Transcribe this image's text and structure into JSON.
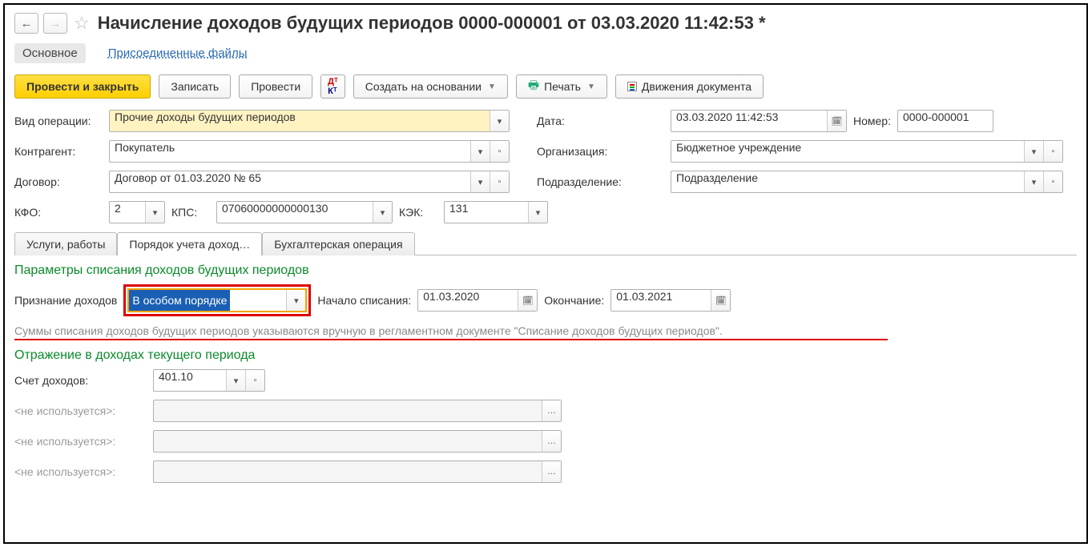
{
  "title": "Начисление доходов будущих периодов 0000-000001 от 03.03.2020 11:42:53 *",
  "subtabs": {
    "main": "Основное",
    "files": "Присоединенные файлы"
  },
  "toolbar": {
    "post_close": "Провести и закрыть",
    "save": "Записать",
    "post": "Провести",
    "create_based": "Создать на основании",
    "print": "Печать",
    "movements": "Движения документа"
  },
  "labels": {
    "op_type": "Вид операции:",
    "date": "Дата:",
    "number": "Номер:",
    "contragent": "Контрагент:",
    "org": "Организация:",
    "contract": "Договор:",
    "division": "Подразделение:",
    "kfo": "КФО:",
    "kps": "КПС:",
    "kek": "КЭК:",
    "recognition": "Признание доходов",
    "start": "Начало списания:",
    "end": "Окончание:",
    "account": "Счет доходов:"
  },
  "fields": {
    "op_type": "Прочие доходы будущих периодов",
    "date": "03.03.2020 11:42:53",
    "number": "0000-000001",
    "contragent": "Покупатель",
    "org": "Бюджетное учреждение",
    "contract": "Договор от 01.03.2020 № 65",
    "division": "Подразделение",
    "kfo": "2",
    "kps": "07060000000000130",
    "kek": "131",
    "recognition": "В особом порядке",
    "start_date": "01.03.2020",
    "end_date": "01.03.2021",
    "account": "401.10"
  },
  "tabs": {
    "t1": "Услуги, работы",
    "t2": "Порядок учета доход…",
    "t3": "Бухгалтерская операция"
  },
  "sections": {
    "params": "Параметры списания доходов будущих периодов",
    "note": "Суммы списания доходов будущих периодов указываются вручную в регламентном документе \"Списание доходов будущих периодов\".",
    "current": "Отражение в доходах текущего периода",
    "unused": "<не используется>:"
  }
}
